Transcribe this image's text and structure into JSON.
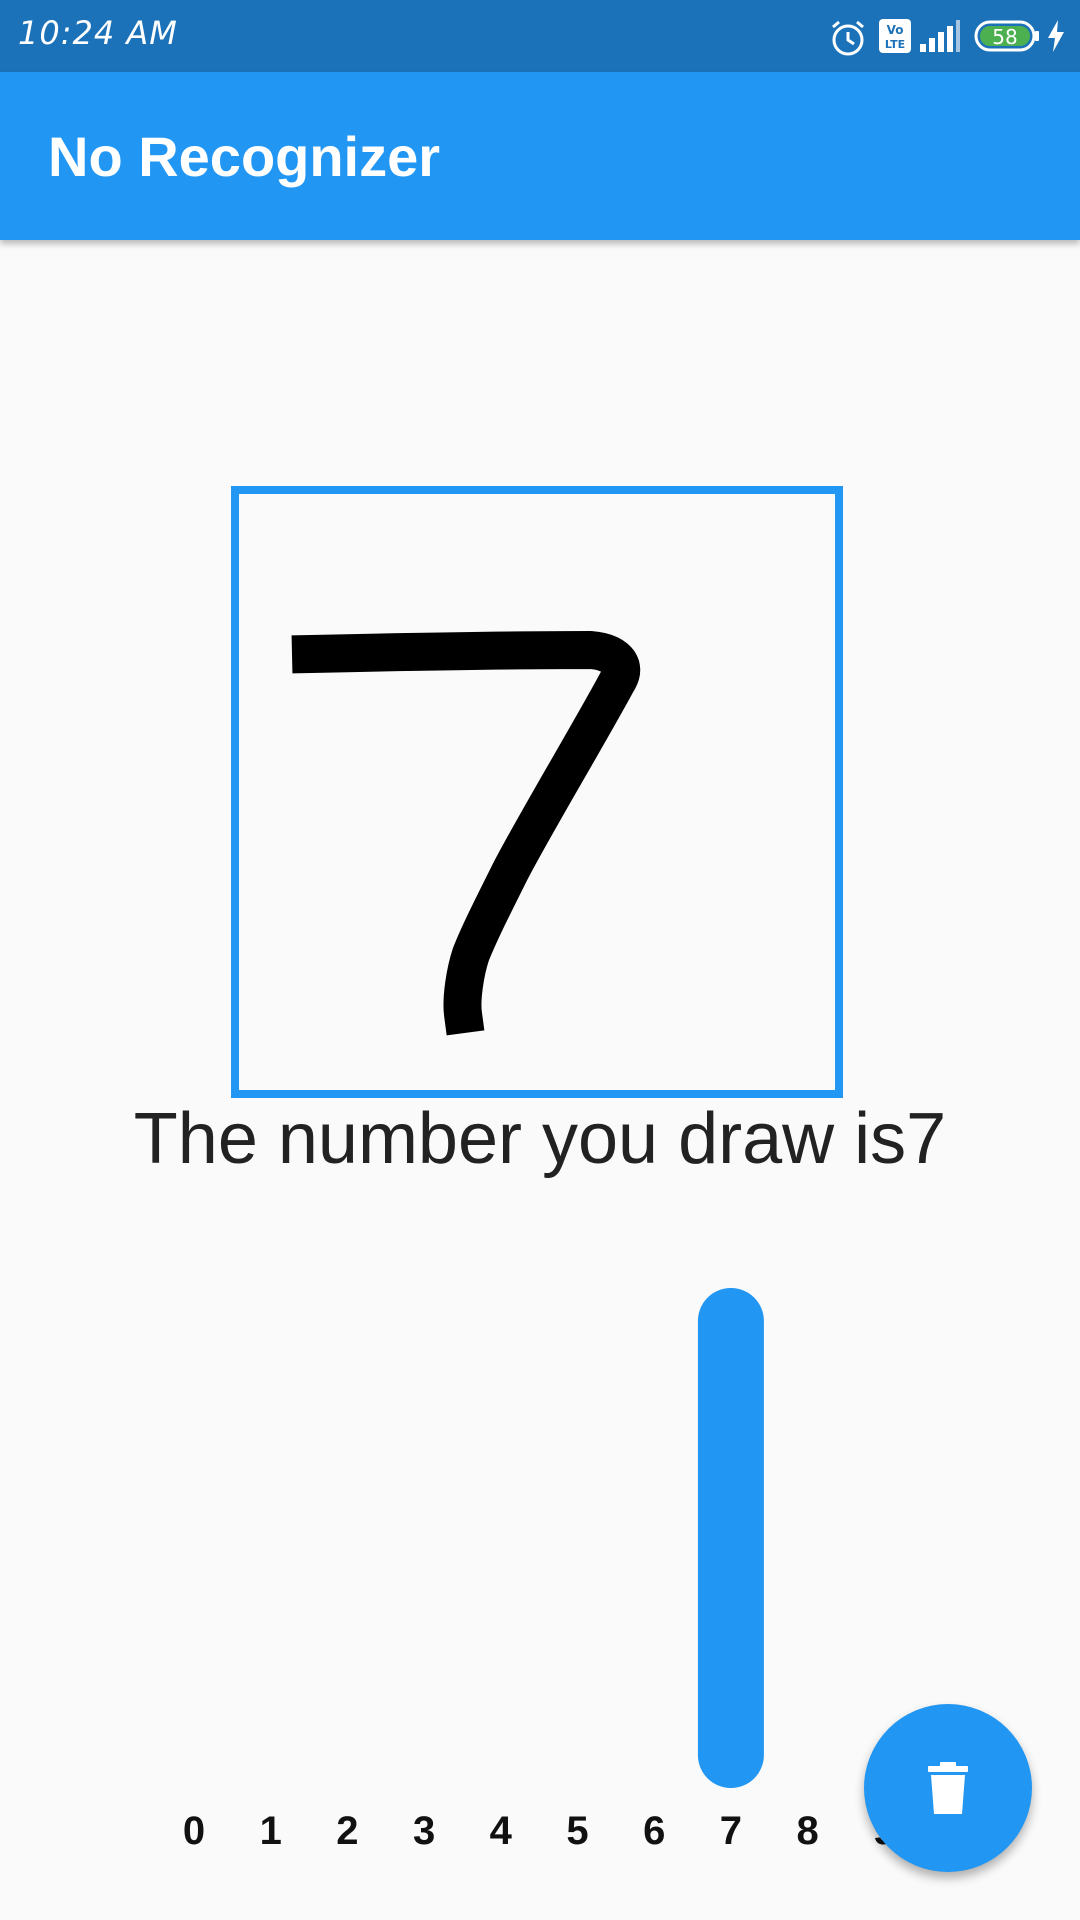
{
  "status_bar": {
    "time": "10:24 AM",
    "battery": "58",
    "icons": [
      "alarm-icon",
      "volte-icon",
      "signal-icon",
      "battery-icon",
      "charging-icon"
    ]
  },
  "app_bar": {
    "title": "No Recognizer"
  },
  "drawing": {
    "description_icon": "handwritten-digit-drawing",
    "stroke_color": "#000000",
    "border_color": "#2196f3"
  },
  "result": {
    "text": "The number you draw is7"
  },
  "fab": {
    "icon": "delete-icon",
    "color": "#2196f3"
  },
  "chart_data": {
    "type": "bar",
    "categories": [
      "0",
      "1",
      "2",
      "3",
      "4",
      "5",
      "6",
      "7",
      "8",
      "9"
    ],
    "values": [
      0,
      0,
      0,
      0,
      0,
      0,
      0,
      1,
      0,
      0
    ],
    "ylim": [
      0,
      1
    ],
    "title": "",
    "xlabel": "",
    "ylabel": "",
    "grid": false,
    "bar_color": "#2196f3"
  }
}
